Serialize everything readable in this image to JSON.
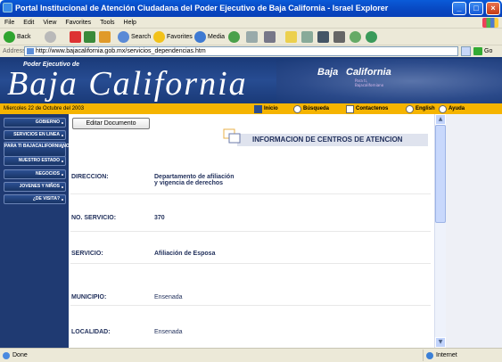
{
  "window": {
    "title": "Portal Institucional de Atención Ciudadana del Poder Ejecutivo de Baja California - Israel Explorer"
  },
  "menu": [
    "File",
    "Edit",
    "View",
    "Favorites",
    "Tools",
    "Help"
  ],
  "toolbar": {
    "back": "Back",
    "search": "Search",
    "favorites": "Favorites",
    "media": "Media"
  },
  "address": {
    "label": "Address",
    "url": "http://www.bajacalifornia.gob.mx/servicios_dependencias.htm",
    "go": "Go"
  },
  "banner": {
    "line1": "Poder Ejecutivo de",
    "title": "Baja California",
    "logo_a": "Baja",
    "logo_b": "California",
    "logo_tag": "Para ti, Bajacaliforniano"
  },
  "datebar": {
    "date": "Miercoles 22 de Octubre del 2003",
    "links": [
      "Inicio",
      "Búsqueda",
      "Contactenos",
      "English",
      "Ayuda"
    ]
  },
  "sidebar": [
    "GOBIERNO",
    "SERVICIOS EN LINEA",
    "PARA TI BAJACALIFORNIANO",
    "NUESTRO ESTADO",
    "NEGOCIOS",
    "JOVENES Y NIÑOS",
    "¿DE VISITA?"
  ],
  "content": {
    "edit_button": "Editar Documento",
    "header": "INFORMACION DE CENTROS DE ATENCION",
    "rows": [
      {
        "key": "DIRECCION:",
        "value": "Departamento de afiliación\ny vigencia de derechos"
      },
      {
        "key": "NO. SERVICIO:",
        "value": "370"
      },
      {
        "key": "SERVICIO:",
        "value": "Afiliación de Esposa"
      },
      {
        "key": "MUNICIPIO:",
        "value": "Ensenada"
      },
      {
        "key": "LOCALIDAD:",
        "value": "Ensenada"
      }
    ]
  },
  "status": {
    "text": "Done",
    "zone": "Internet"
  }
}
